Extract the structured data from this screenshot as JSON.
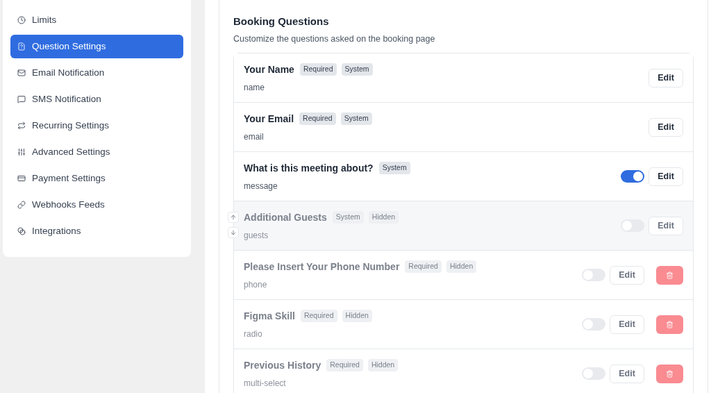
{
  "sidebar": {
    "items": [
      {
        "label": "Limits",
        "selected": false
      },
      {
        "label": "Question Settings",
        "selected": true
      },
      {
        "label": "Email Notification",
        "selected": false
      },
      {
        "label": "SMS Notification",
        "selected": false
      },
      {
        "label": "Recurring Settings",
        "selected": false
      },
      {
        "label": "Advanced Settings",
        "selected": false
      },
      {
        "label": "Payment Settings",
        "selected": false
      },
      {
        "label": "Webhooks Feeds",
        "selected": false
      },
      {
        "label": "Integrations",
        "selected": false
      }
    ]
  },
  "booking_questions": {
    "title": "Booking Questions",
    "subtitle": "Customize the questions asked on the booking page",
    "questions": [
      {
        "label": "Your Name",
        "key": "name",
        "tags": [
          "Required",
          "System"
        ],
        "hidden": false,
        "highlighted": false,
        "edit": "Edit",
        "deletable": false
      },
      {
        "label": "Your Email",
        "key": "email",
        "tags": [
          "Required",
          "System"
        ],
        "hidden": false,
        "highlighted": false,
        "edit": "Edit",
        "deletable": false
      },
      {
        "label": "What is this meeting about?",
        "key": "message",
        "tags": [
          "System"
        ],
        "hidden": false,
        "highlighted": false,
        "toggle": true,
        "edit": "Edit",
        "deletable": false
      },
      {
        "label": "Additional Guests",
        "key": "guests",
        "tags": [
          "System",
          "Hidden"
        ],
        "hidden": true,
        "highlighted": true,
        "toggle": false,
        "edit": "Edit",
        "deletable": false
      },
      {
        "label": "Please Insert Your Phone Number",
        "key": "phone",
        "tags": [
          "Required",
          "Hidden"
        ],
        "hidden": true,
        "highlighted": false,
        "toggle": false,
        "edit": "Edit",
        "deletable": true
      },
      {
        "label": "Figma Skill",
        "key": "radio",
        "tags": [
          "Required",
          "Hidden"
        ],
        "hidden": true,
        "highlighted": false,
        "toggle": false,
        "edit": "Edit",
        "deletable": true
      },
      {
        "label": "Previous History",
        "key": "multi-select",
        "tags": [
          "Required",
          "Hidden"
        ],
        "hidden": true,
        "highlighted": false,
        "toggle": false,
        "edit": "Edit",
        "deletable": true
      }
    ]
  }
}
